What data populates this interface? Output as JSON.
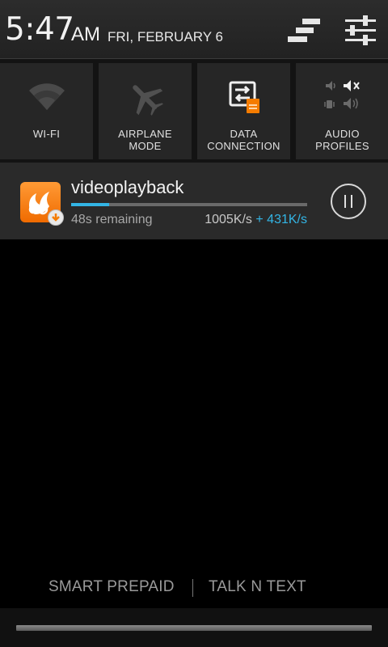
{
  "status": {
    "time": "5:47",
    "ampm": "AM",
    "date": "FRI, FEBRUARY 6"
  },
  "header_icons": [
    "clear-notifications-icon",
    "settings-sliders-icon"
  ],
  "quick_settings": [
    {
      "label": "WI-FI",
      "icon": "wifi-icon"
    },
    {
      "label": "AIRPLANE\nMODE",
      "icon": "airplane-icon"
    },
    {
      "label": "DATA\nCONNECTION",
      "icon": "data-connection-icon"
    },
    {
      "label": "AUDIO\nPROFILES",
      "icon": "audio-profiles-icon"
    }
  ],
  "notification": {
    "app_icon": "uc-browser-download-icon",
    "title": "videoplayback",
    "progress": 0.16,
    "remaining": "48s remaining",
    "speed_down": "1005K/s",
    "speed_up": "+ 431K/s",
    "action_icon": "pause-icon"
  },
  "carriers": [
    "SMART PREPAID",
    "TALK N TEXT"
  ],
  "colors": {
    "accent": "#33b5e5",
    "app_orange": "#f57c00"
  }
}
